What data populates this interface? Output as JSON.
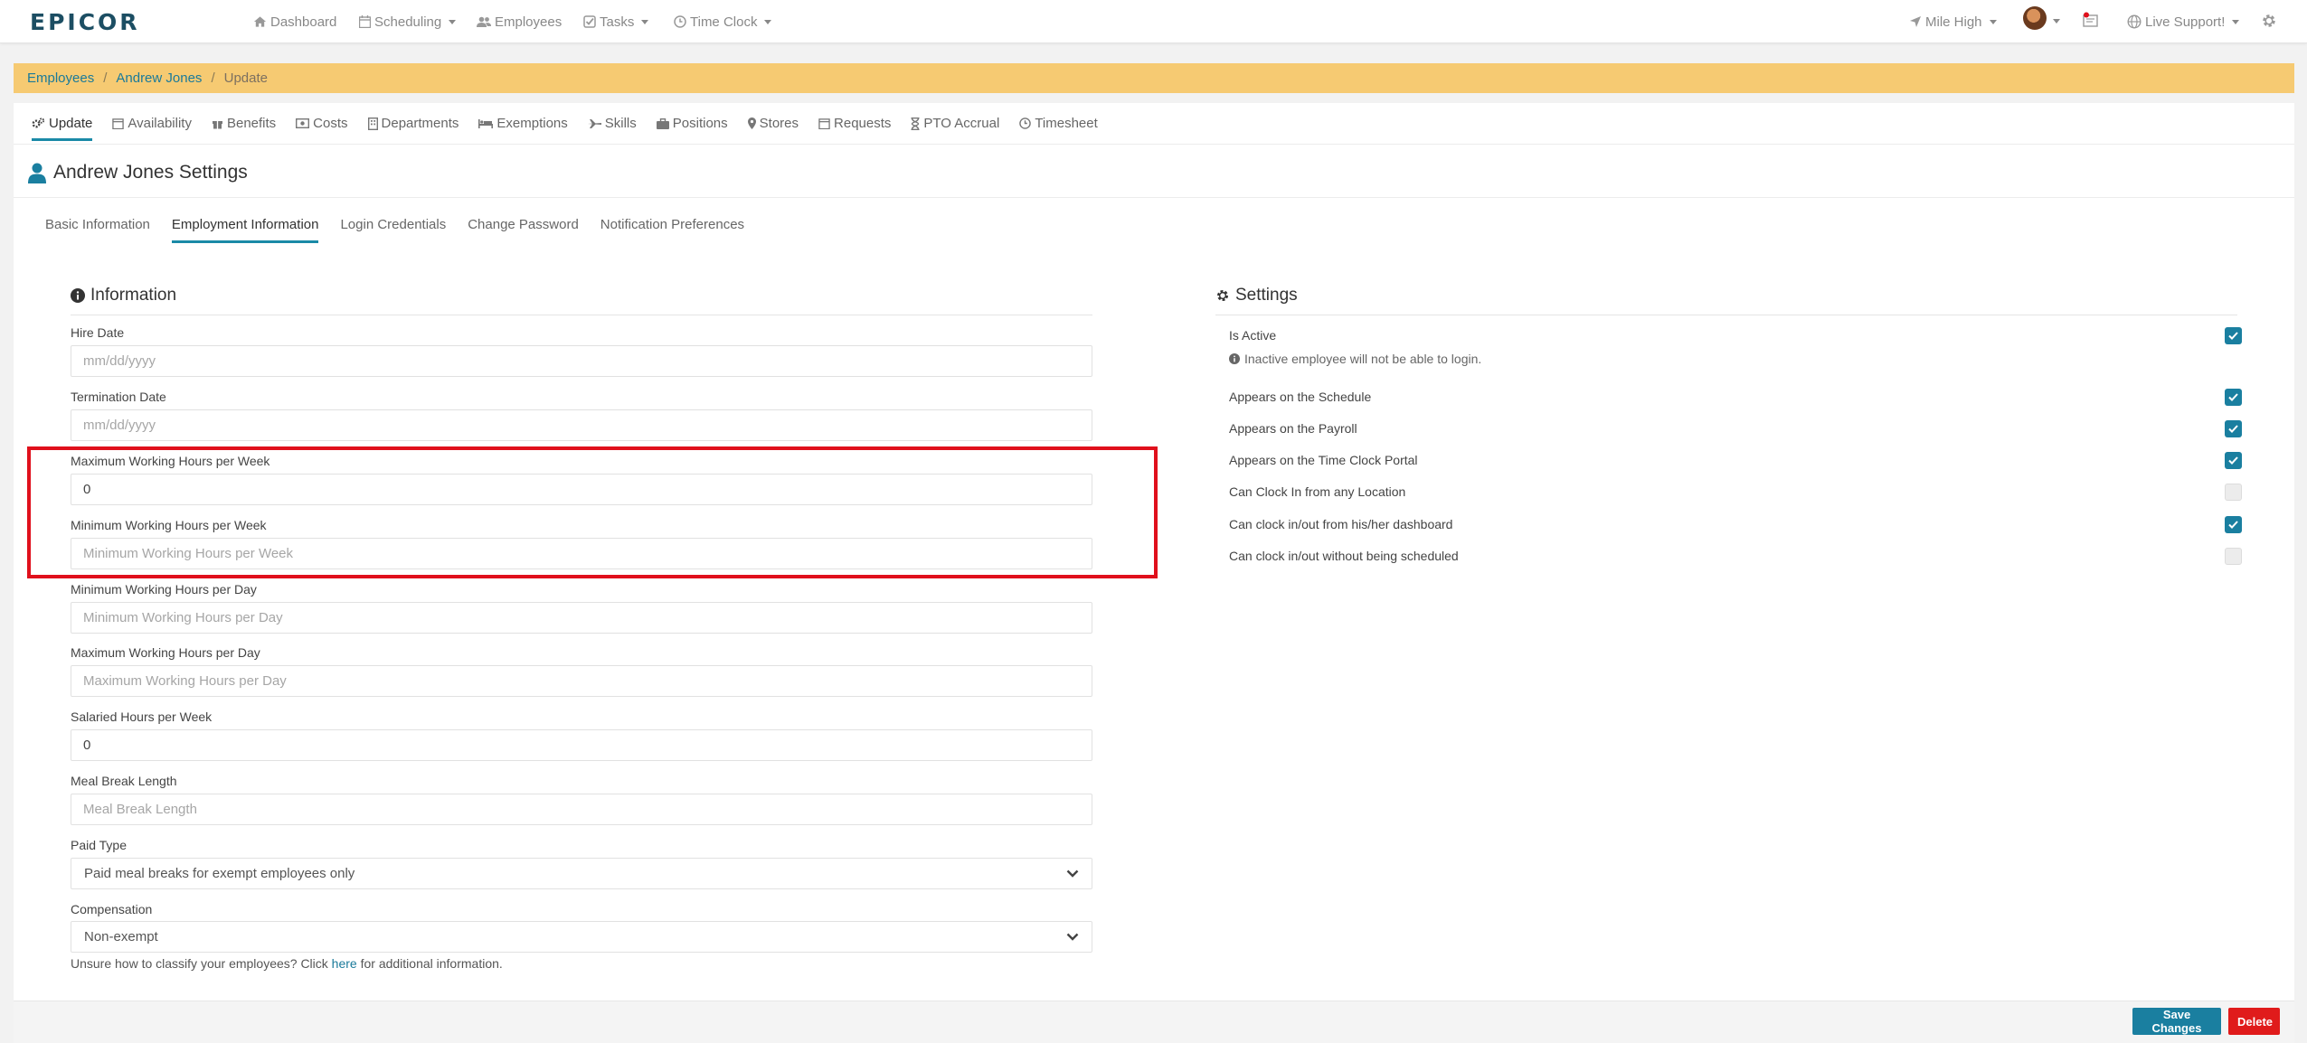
{
  "app": {
    "logo": "EPICOR",
    "nav": [
      {
        "label": "Dashboard",
        "icon": "home-icon"
      },
      {
        "label": "Scheduling",
        "icon": "calendar-icon"
      },
      {
        "label": "Employees",
        "icon": "users-icon"
      },
      {
        "label": "Tasks",
        "icon": "check-square-icon"
      },
      {
        "label": "Time Clock",
        "icon": "clock-icon"
      }
    ],
    "right": {
      "location": "Mile High",
      "support": "Live Support!"
    }
  },
  "breadcrumb": [
    "Employees",
    "Andrew Jones",
    "Update"
  ],
  "subtabs": [
    {
      "label": "Update",
      "icon": "cogs-icon"
    },
    {
      "label": "Availability",
      "icon": "calendar-icon"
    },
    {
      "label": "Benefits",
      "icon": "gift-icon"
    },
    {
      "label": "Costs",
      "icon": "money-icon"
    },
    {
      "label": "Departments",
      "icon": "building-icon"
    },
    {
      "label": "Exemptions",
      "icon": "bed-icon"
    },
    {
      "label": "Skills",
      "icon": "plane-icon"
    },
    {
      "label": "Positions",
      "icon": "briefcase-icon"
    },
    {
      "label": "Stores",
      "icon": "map-marker-icon"
    },
    {
      "label": "Requests",
      "icon": "calendar-icon"
    },
    {
      "label": "PTO Accrual",
      "icon": "hourglass-icon"
    },
    {
      "label": "Timesheet",
      "icon": "clock-icon"
    }
  ],
  "page_title": "Andrew Jones Settings",
  "form_tabs": [
    "Basic Information",
    "Employment Information",
    "Login Credentials",
    "Change Password",
    "Notification Preferences"
  ],
  "information": {
    "heading": "Information",
    "fields": [
      {
        "label": "Hire Date",
        "value": "",
        "placeholder": "mm/dd/yyyy"
      },
      {
        "label": "Termination Date",
        "value": "",
        "placeholder": "mm/dd/yyyy"
      },
      {
        "label": "Maximum Working Hours per Week",
        "value": "0",
        "placeholder": ""
      },
      {
        "label": "Minimum Working Hours per Week",
        "value": "",
        "placeholder": "Minimum Working Hours per Week"
      },
      {
        "label": "Minimum Working Hours per Day",
        "value": "",
        "placeholder": "Minimum Working Hours per Day"
      },
      {
        "label": "Maximum Working Hours per Day",
        "value": "",
        "placeholder": "Maximum Working Hours per Day"
      },
      {
        "label": "Salaried Hours per Week",
        "value": "0",
        "placeholder": ""
      },
      {
        "label": "Meal Break Length",
        "value": "",
        "placeholder": "Meal Break Length"
      }
    ],
    "paid_type": {
      "label": "Paid Type",
      "value": "Paid meal breaks for exempt employees only"
    },
    "compensation": {
      "label": "Compensation",
      "value": "Non-exempt"
    },
    "hint": {
      "before": "Unsure how to classify your employees? Click ",
      "link": "here",
      "after": " for additional information."
    }
  },
  "settings": {
    "heading": "Settings",
    "inactive_note": "Inactive employee will not be able to login.",
    "items": [
      {
        "label": "Is Active",
        "checked": true
      },
      {
        "label": "Appears on the Schedule",
        "checked": true
      },
      {
        "label": "Appears on the Payroll",
        "checked": true
      },
      {
        "label": "Appears on the Time Clock Portal",
        "checked": true
      },
      {
        "label": "Can Clock In from any Location",
        "checked": false
      },
      {
        "label": "Can clock in/out from his/her dashboard",
        "checked": true
      },
      {
        "label": "Can clock in/out without being scheduled",
        "checked": false
      }
    ]
  },
  "actions": {
    "save": "Save Changes",
    "delete": "Delete"
  },
  "colors": {
    "accent": "#1a7fa0",
    "breadcrumb_bg": "#f6ca72",
    "highlight": "#e0101c",
    "danger": "#e01b1b"
  }
}
